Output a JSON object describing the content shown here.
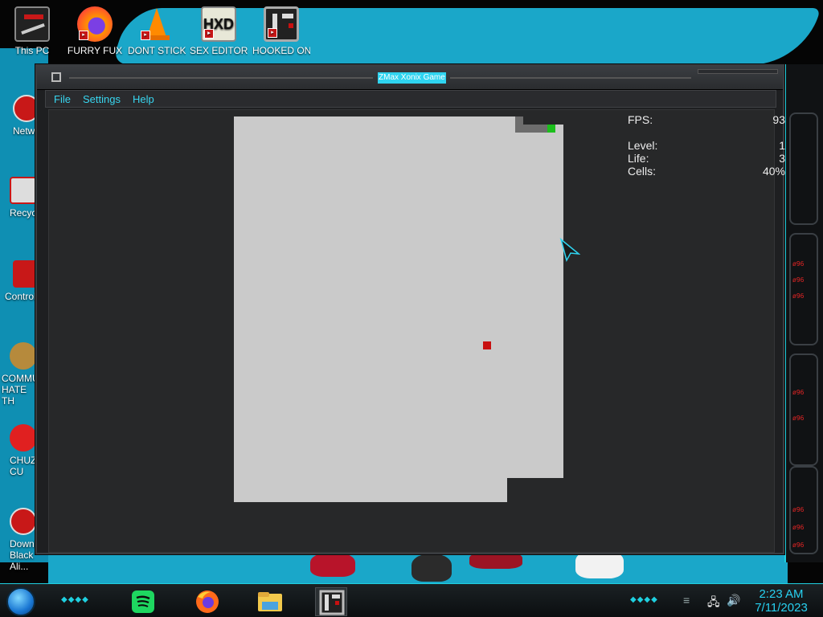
{
  "window": {
    "title": "ZMax Xonix Game",
    "menu": [
      "File",
      "Settings",
      "Help"
    ]
  },
  "stats": {
    "fps_label": "FPS:",
    "fps_value": "93",
    "level_label": "Level:",
    "level_value": "1",
    "life_label": "Life:",
    "life_value": "3",
    "cells_label": "Cells:",
    "cells_value": "40%"
  },
  "desktop": {
    "top_icons": [
      "This PC",
      "FURRY FUX",
      "DONT STICK THIS IN YO",
      "SEX EDITOR",
      "HOOKED ON XONIX"
    ],
    "left_icons": [
      "Netw",
      "Recycl",
      "Control",
      "COMMU HATE TH",
      "CHUZ CU",
      "Downl Black Ali..."
    ]
  },
  "taskbar": {
    "time": "2:23 AM",
    "date": "7/11/2023"
  },
  "skin": {
    "red_readouts": [
      "ø96",
      "ø96",
      "ø96",
      "ø96",
      "ø96",
      "ø96",
      "ø96",
      "ø96"
    ]
  },
  "colors": {
    "accent": "#2fd4f0",
    "menu_text": "#38d6f0",
    "board": "#cacaca",
    "player": "#1bbf1b",
    "enemy": "#c81010",
    "trail": "#6d6d6d"
  },
  "icons": {
    "start": "start-orb-icon",
    "spotify": "spotify-icon",
    "firefox": "firefox-icon",
    "explorer": "file-explorer-icon",
    "xonix": "xonix-app-icon",
    "network": "network-icon",
    "volume": "volume-icon"
  }
}
